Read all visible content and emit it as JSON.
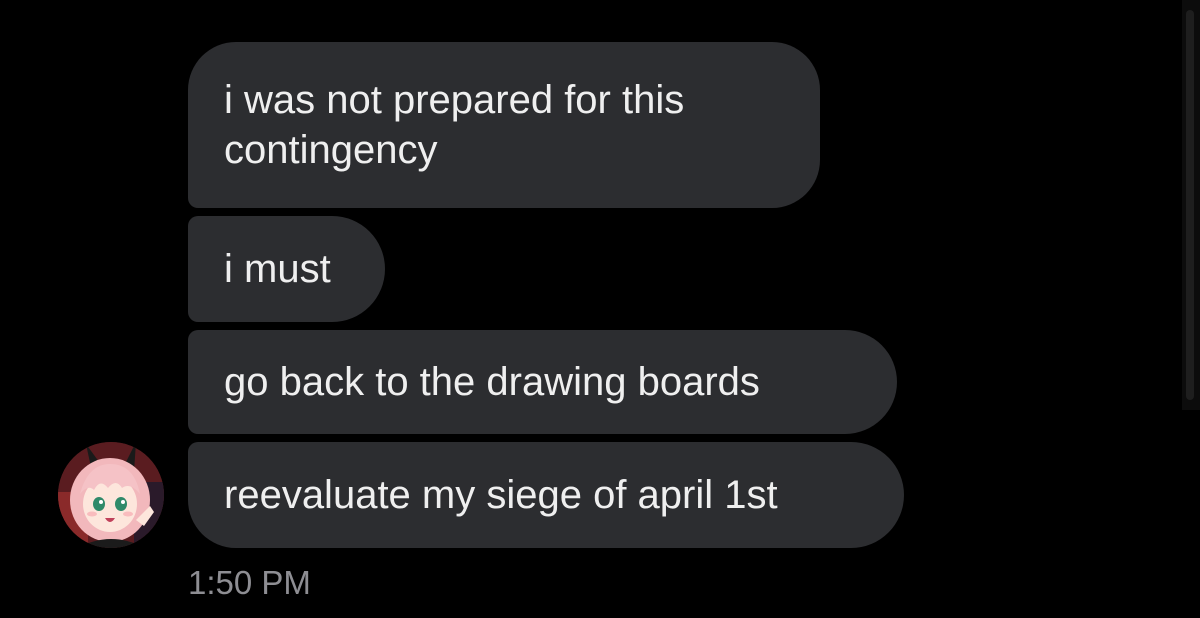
{
  "conversation": {
    "messages": [
      {
        "text": "i was not prepared for this contingency"
      },
      {
        "text": "i must"
      },
      {
        "text": "go back to the drawing boards"
      },
      {
        "text": "reevaluate my siege of april 1st"
      }
    ],
    "timestamp": "1:50 PM"
  },
  "avatar": {
    "description_icon": "anime-girl-avatar-icon"
  },
  "colors": {
    "background": "#000000",
    "bubble": "#2c2d30",
    "bubble_text": "#efefef",
    "timestamp": "#8e8e93"
  }
}
